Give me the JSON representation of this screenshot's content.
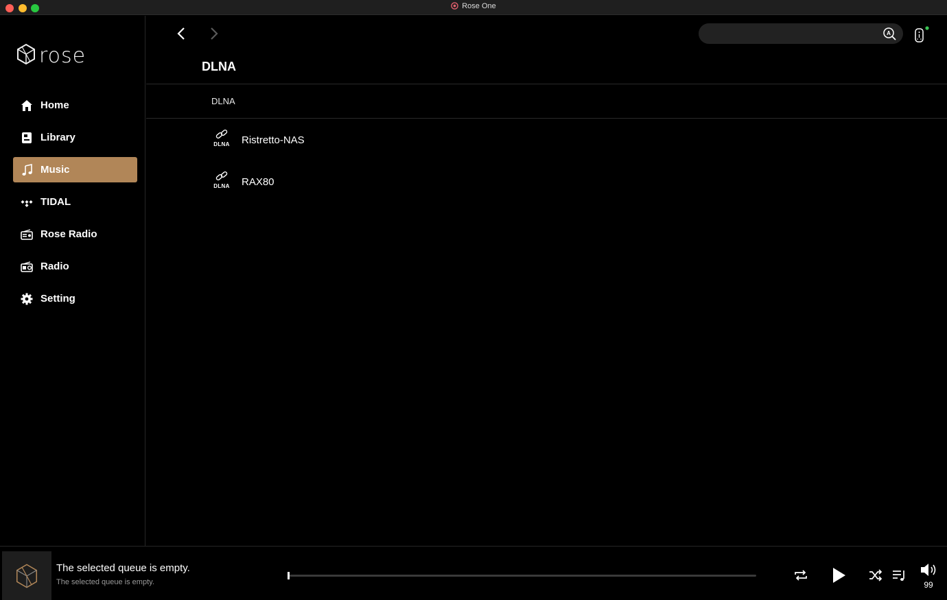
{
  "window": {
    "title": "Rose One",
    "icon": "rose-app-icon"
  },
  "brand": {
    "logo_text": "rose",
    "logo_icon": "rose-logo-icon"
  },
  "sidebar": {
    "items": [
      {
        "label": "Home",
        "icon": "home-icon"
      },
      {
        "label": "Library",
        "icon": "library-icon"
      },
      {
        "label": "Music",
        "icon": "music-note-icon",
        "active": true
      },
      {
        "label": "TIDAL",
        "icon": "tidal-icon"
      },
      {
        "label": "Rose Radio",
        "icon": "rose-radio-icon"
      },
      {
        "label": "Radio",
        "icon": "radio-icon"
      },
      {
        "label": "Setting",
        "icon": "gear-icon"
      }
    ],
    "active_color": "#b18658"
  },
  "header": {
    "search_placeholder": "",
    "search_icon": "search-icon",
    "remote_icon": "remote-icon",
    "remote_status_color": "#3ac454"
  },
  "page": {
    "title": "DLNA",
    "breadcrumb": "DLNA",
    "devices": [
      {
        "name": "Ristretto-NAS",
        "tag": "DLNA",
        "icon": "dlna-link-icon"
      },
      {
        "name": "RAX80",
        "tag": "DLNA",
        "icon": "dlna-link-icon"
      }
    ]
  },
  "player": {
    "title": "The selected queue is empty.",
    "subtitle": "The selected queue is empty.",
    "progress": 0,
    "volume": "99",
    "controls": [
      "repeat-icon",
      "play-icon",
      "shuffle-icon",
      "queue-icon",
      "volume-icon"
    ]
  }
}
